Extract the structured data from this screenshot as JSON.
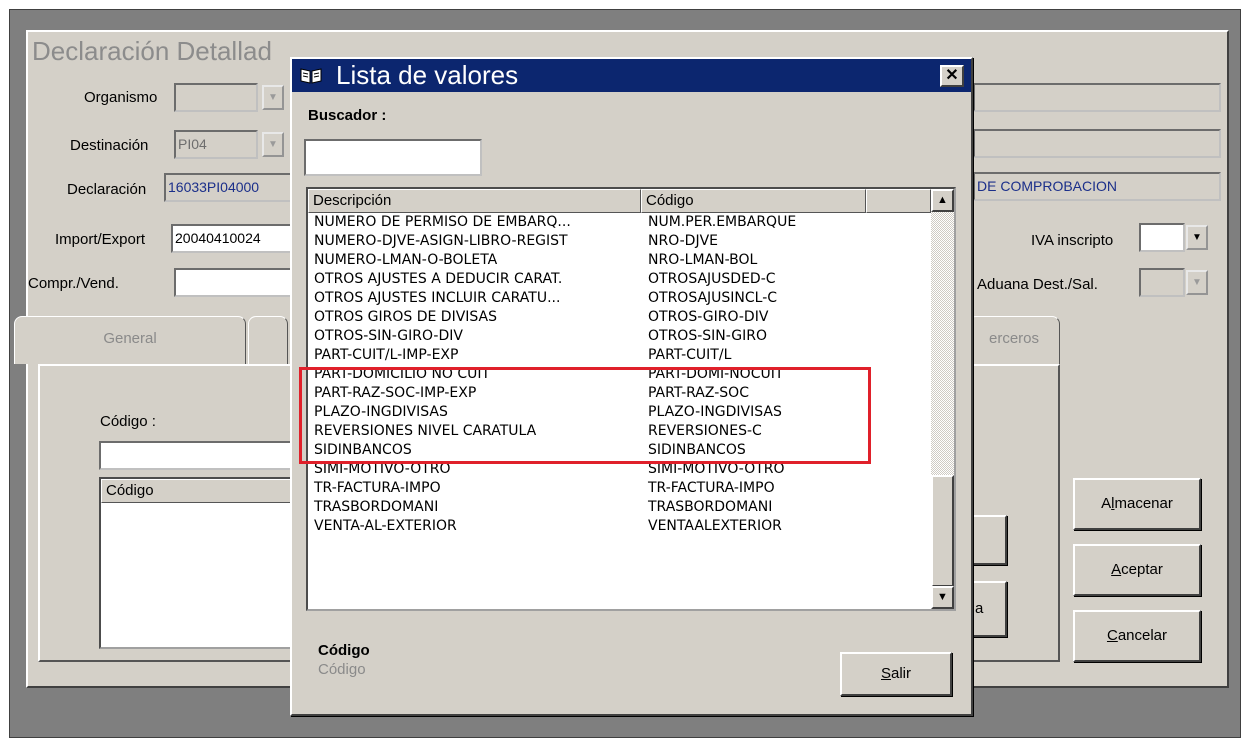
{
  "main_window": {
    "title": "Declaración Detallad",
    "fields": {
      "organismo": {
        "label": "Organismo",
        "value": ""
      },
      "destinacion": {
        "label": "Destinación",
        "value": "PI04"
      },
      "declaracion": {
        "label": "Declaración",
        "value": "16033PI04000"
      },
      "import_export": {
        "label": "Import/Export",
        "value": "20040410024"
      },
      "compr_vend": {
        "label": "Compr./Vend.",
        "value": ""
      },
      "estado": {
        "value": "DE COMPROBACION"
      },
      "iva_inscripto": {
        "label": "IVA inscripto",
        "value": ""
      },
      "aduana_dest_sal": {
        "label": "Aduana Dest./Sal.",
        "value": ""
      }
    },
    "tabs": {
      "general": "General",
      "terceros": "erceros"
    },
    "codigo_label": "Código :",
    "codigo_input": "",
    "grid_header": "Código",
    "partial_button_label": "a",
    "buttons": {
      "almacenar": "Almacenar",
      "aceptar": "Aceptar",
      "cancelar": "Cancelar"
    }
  },
  "dialog": {
    "title": "Lista de valores",
    "buscador_label": "Buscador :",
    "buscador_value": "",
    "columns": [
      "Descripción",
      "Código"
    ],
    "rows": [
      {
        "descripcion": "NUMERO DE PERMISO DE EMBARQ...",
        "codigo": "NUM.PER.EMBARQUE"
      },
      {
        "descripcion": "NUMERO-DJVE-ASIGN-LIBRO-REGIST",
        "codigo": "NRO-DJVE"
      },
      {
        "descripcion": "NUMERO-LMAN-O-BOLETA",
        "codigo": "NRO-LMAN-BOL"
      },
      {
        "descripcion": "OTROS AJUSTES A DEDUCIR CARAT.",
        "codigo": "OTROSAJUSDED-C"
      },
      {
        "descripcion": "OTROS AJUSTES INCLUIR CARATU...",
        "codigo": "OTROSAJUSINCL-C"
      },
      {
        "descripcion": "OTROS GIROS DE DIVISAS",
        "codigo": "OTROS-GIRO-DIV"
      },
      {
        "descripcion": "OTROS-SIN-GIRO-DIV",
        "codigo": "OTROS-SIN-GIRO"
      },
      {
        "descripcion": "PART-CUIT/L-IMP-EXP",
        "codigo": "PART-CUIT/L"
      },
      {
        "descripcion": "PART-DOMICILIO NO CUIT",
        "codigo": "PART-DOMI-NOCUIT"
      },
      {
        "descripcion": "PART-RAZ-SOC-IMP-EXP",
        "codigo": "PART-RAZ-SOC"
      },
      {
        "descripcion": "PLAZO-INGDIVISAS",
        "codigo": "PLAZO-INGDIVISAS"
      },
      {
        "descripcion": "REVERSIONES NIVEL CARATULA",
        "codigo": "REVERSIONES-C"
      },
      {
        "descripcion": "SIDINBANCOS",
        "codigo": "SIDINBANCOS"
      },
      {
        "descripcion": "SIMI-MOTIVO-OTRO",
        "codigo": "SIMI-MOTIVO-OTRO"
      },
      {
        "descripcion": "TR-FACTURA-IMPO",
        "codigo": "TR-FACTURA-IMPO"
      },
      {
        "descripcion": "TRASBORDOMANI",
        "codigo": "TRASBORDOMANI"
      },
      {
        "descripcion": "VENTA-AL-EXTERIOR",
        "codigo": "VENTAALEXTERIOR"
      }
    ],
    "footer_label": "Código",
    "footer_value": "Código",
    "salir_label": "Salir",
    "highlight_color": "#e0202a",
    "title_bar_color": "#0c266f"
  }
}
